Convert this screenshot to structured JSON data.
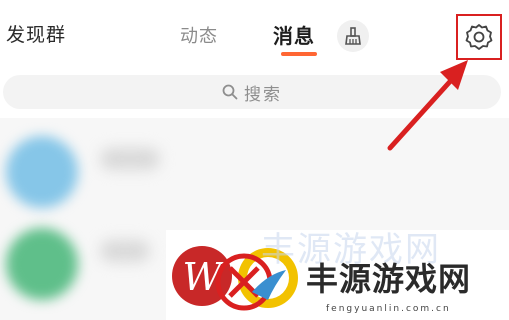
{
  "header": {
    "discover_label": "发现群",
    "tabs": [
      {
        "label": "动态",
        "active": false
      },
      {
        "label": "消息",
        "active": true
      }
    ],
    "broom_icon": "broom-icon",
    "settings_icon": "gear-icon"
  },
  "search": {
    "placeholder": "搜索",
    "icon": "search-icon"
  },
  "watermark": {
    "logo_letter": "W",
    "brand_text": "丰源游戏网",
    "url": "fengyuanlin.com.cn"
  },
  "colors": {
    "accent": "#ff6633",
    "annotation_red": "#d92020",
    "search_bg": "#f3f3f3"
  }
}
